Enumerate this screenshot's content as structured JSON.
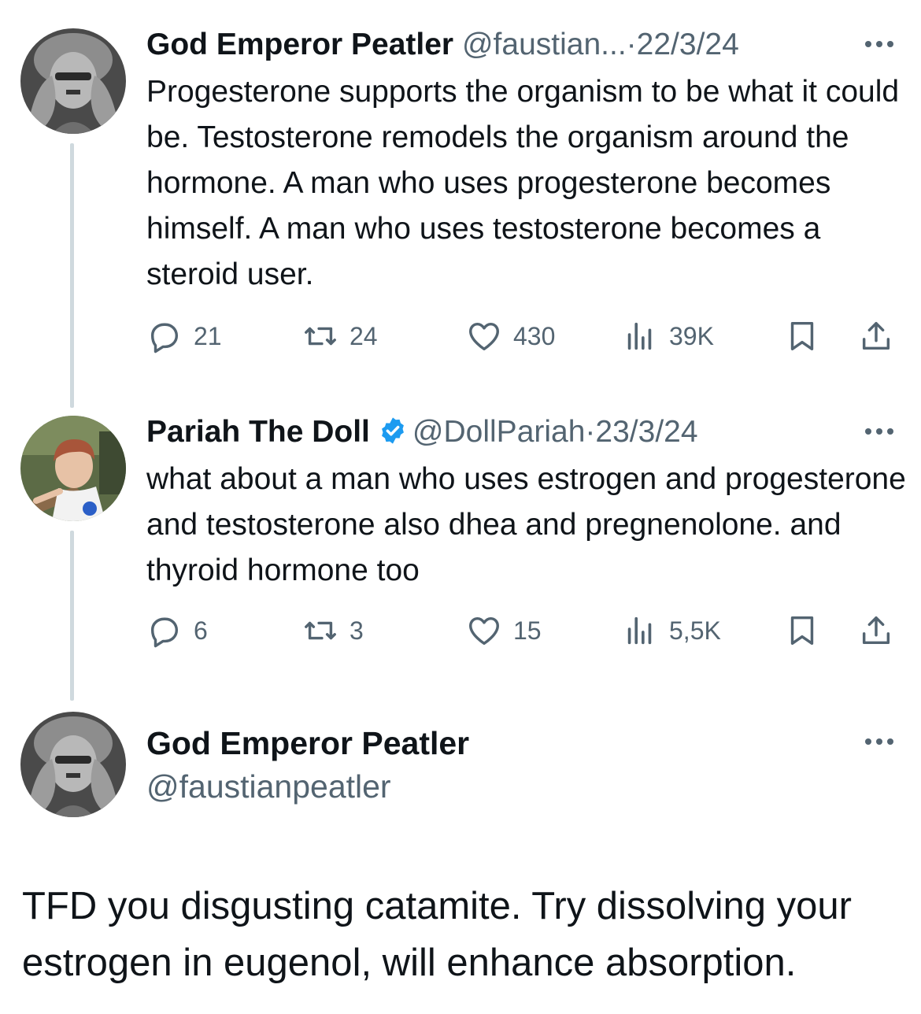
{
  "tweets": [
    {
      "author": "God Emperor Peatler",
      "handle": "@faustian...",
      "separator": "·",
      "date": "22/3/24",
      "text": "Progesterone supports the organism to be what it could be. Testosterone remodels the organism around the hormone. A man who uses progesterone becomes himself. A man who uses testosterone becomes a steroid user.",
      "replies": "21",
      "reposts": "24",
      "likes": "430",
      "views": "39K"
    },
    {
      "author": "Pariah The Doll",
      "verified": true,
      "handle": "@DollPariah",
      "separator": "·",
      "date": "23/3/24",
      "text": "what about a man who uses estrogen and progesterone and testosterone also dhea and pregnenolone. and thyroid hormone too",
      "replies": "6",
      "reposts": "3",
      "likes": "15",
      "views": "5,5K"
    }
  ],
  "main_tweet": {
    "author": "God Emperor Peatler",
    "handle": "@faustianpeatler",
    "text": "TFD you disgusting catamite. Try dissolving your estrogen in eugenol, will enhance absorption."
  },
  "colors": {
    "text": "#0f1419",
    "secondary": "#536471",
    "thread_line": "#cfd9de",
    "verified_blue": "#1d9bf0"
  },
  "icons": [
    "reply-icon",
    "repost-icon",
    "like-icon",
    "views-icon",
    "bookmark-icon",
    "share-icon",
    "more-icon",
    "verified-badge-icon"
  ]
}
